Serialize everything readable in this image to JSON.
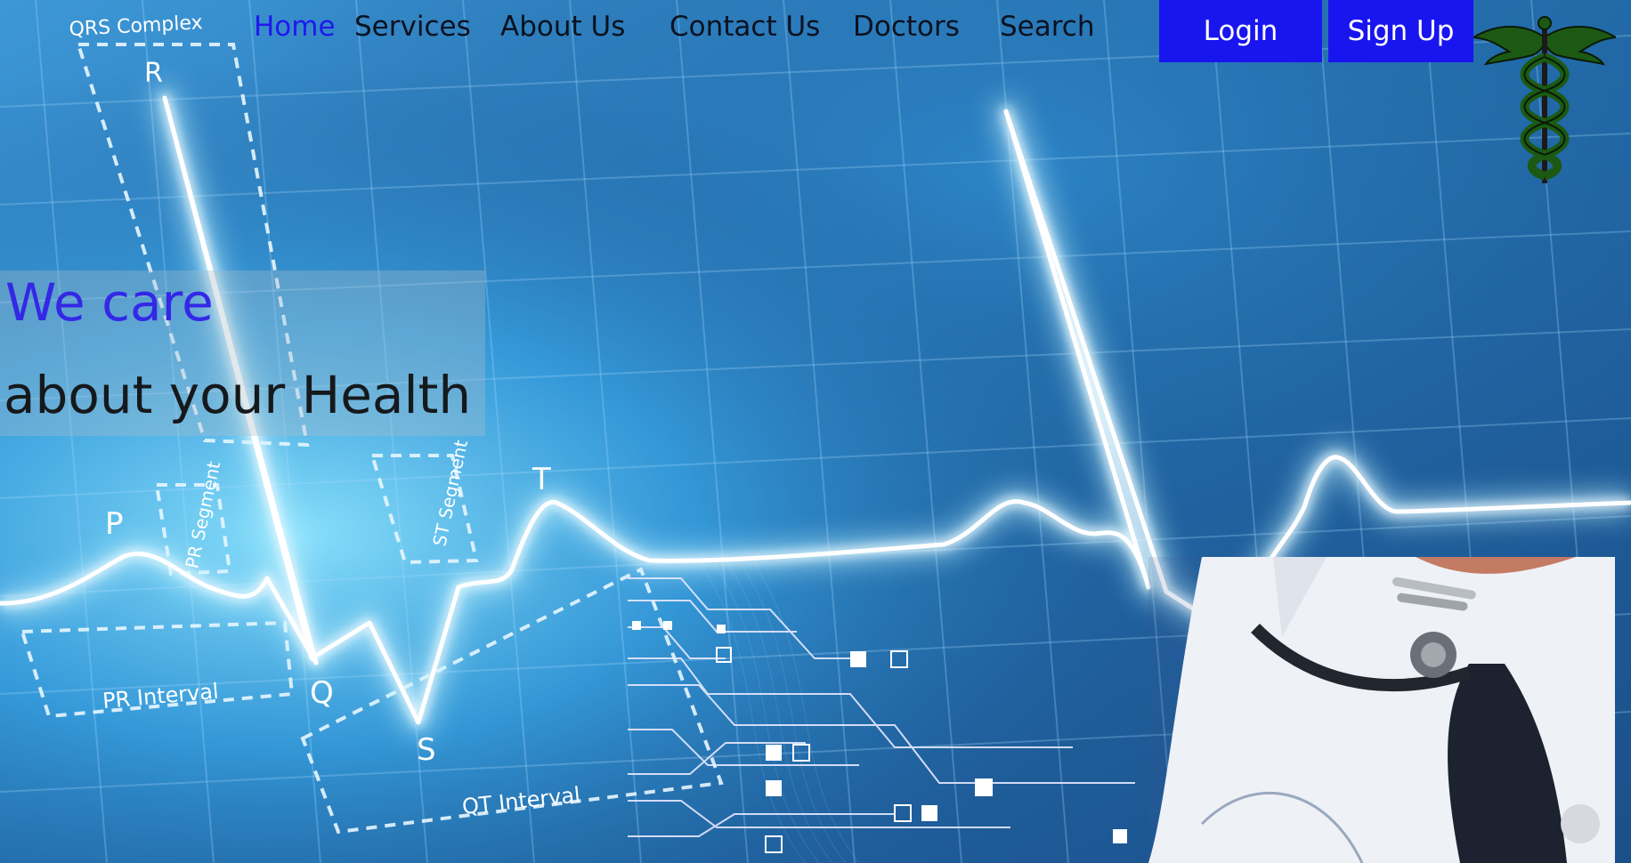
{
  "nav": {
    "items": [
      {
        "label": "Home",
        "active": true
      },
      {
        "label": "Services"
      },
      {
        "label": "About Us"
      },
      {
        "label": "Contact Us"
      },
      {
        "label": "Doctors"
      },
      {
        "label": "Search"
      }
    ],
    "login_label": "Login",
    "signup_label": "Sign Up"
  },
  "hero": {
    "tagline_line1": "We care",
    "tagline_line2": "about your Health",
    "ecg_labels": {
      "qrs": "QRS Complex",
      "r": "R",
      "p": "P",
      "q": "Q",
      "s": "S",
      "t": "T",
      "pr_segment": "PR Segment",
      "st_segment": "ST Segment",
      "pr_interval": "PR Interval",
      "qt_interval": "QT Interval"
    }
  },
  "colors": {
    "accent": "#1915ef",
    "active_link": "#2018ee",
    "background": "#1f5f9c",
    "ecg_glow": "#e8f8ff"
  },
  "icons": {
    "logo": "caduceus-icon"
  }
}
